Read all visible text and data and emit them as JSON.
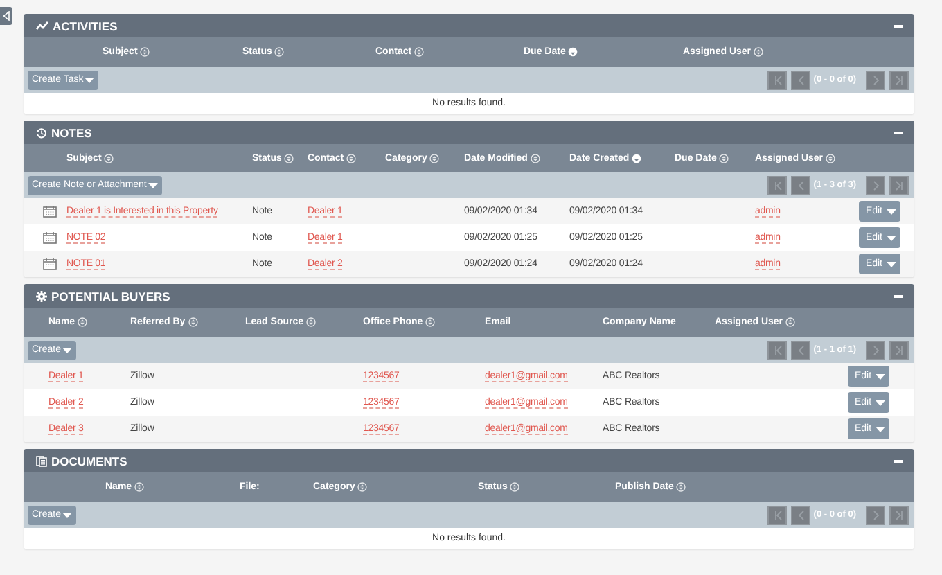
{
  "sidebar_toggle": {
    "kind": "collapse"
  },
  "panels": [
    {
      "title": "ACTIVITIES",
      "columns": [
        {
          "label": "Subject",
          "sortable": true,
          "sorted": false
        },
        {
          "label": "Status",
          "sortable": true,
          "sorted": false
        },
        {
          "label": "Contact",
          "sortable": true,
          "sorted": false
        },
        {
          "label": "Due Date",
          "sortable": true,
          "sorted": true
        },
        {
          "label": "Assigned User",
          "sortable": true,
          "sorted": false
        }
      ],
      "create_label": "Create Task",
      "pager": "(0 - 0 of 0)",
      "empty_message": "No results found."
    },
    {
      "title": "NOTES",
      "columns": [
        {
          "label": "Subject",
          "sortable": true,
          "sorted": false
        },
        {
          "label": "Status",
          "sortable": true,
          "sorted": false
        },
        {
          "label": "Contact",
          "sortable": true,
          "sorted": false
        },
        {
          "label": "Category",
          "sortable": true,
          "sorted": false
        },
        {
          "label": "Date Modified",
          "sortable": true,
          "sorted": false
        },
        {
          "label": "Date Created",
          "sortable": true,
          "sorted": true
        },
        {
          "label": "Due Date",
          "sortable": true,
          "sorted": false
        },
        {
          "label": "Assigned User",
          "sortable": true,
          "sorted": false
        }
      ],
      "create_label": "Create Note or Attachment",
      "pager": "(1 - 3 of 3)",
      "rows": [
        {
          "cells": [
            {
              "kind": "link",
              "text": "Dealer 1 is Interested in this Property"
            },
            {
              "kind": "text",
              "text": "Note"
            },
            {
              "kind": "link",
              "text": "Dealer 1"
            },
            {
              "kind": "blank"
            },
            {
              "kind": "text",
              "text": "09/02/2020 01:34"
            },
            {
              "kind": "text",
              "text": "09/02/2020 01:34"
            },
            {
              "kind": "blank"
            },
            {
              "kind": "link",
              "text": "admin"
            },
            {
              "kind": "edit",
              "text": "Edit"
            }
          ]
        },
        {
          "cells": [
            {
              "kind": "link",
              "text": "NOTE 02"
            },
            {
              "kind": "text",
              "text": "Note"
            },
            {
              "kind": "link",
              "text": "Dealer 1"
            },
            {
              "kind": "blank"
            },
            {
              "kind": "text",
              "text": "09/02/2020 01:25"
            },
            {
              "kind": "text",
              "text": "09/02/2020 01:25"
            },
            {
              "kind": "blank"
            },
            {
              "kind": "link",
              "text": "admin"
            },
            {
              "kind": "edit",
              "text": "Edit"
            }
          ]
        },
        {
          "cells": [
            {
              "kind": "link",
              "text": "NOTE 01"
            },
            {
              "kind": "text",
              "text": "Note"
            },
            {
              "kind": "link",
              "text": "Dealer 2"
            },
            {
              "kind": "blank"
            },
            {
              "kind": "text",
              "text": "09/02/2020 01:24"
            },
            {
              "kind": "text",
              "text": "09/02/2020 01:24"
            },
            {
              "kind": "blank"
            },
            {
              "kind": "link",
              "text": "admin"
            },
            {
              "kind": "edit",
              "text": "Edit"
            }
          ]
        }
      ]
    },
    {
      "title": "POTENTIAL BUYERS",
      "columns": [
        {
          "label": "Name",
          "sortable": true,
          "sorted": false
        },
        {
          "label": "Referred By",
          "sortable": true,
          "sorted": false
        },
        {
          "label": "Lead Source",
          "sortable": true,
          "sorted": false
        },
        {
          "label": "Office Phone",
          "sortable": true,
          "sorted": false
        },
        {
          "label": "Email",
          "sortable": false
        },
        {
          "label": "Company Name",
          "sortable": false
        },
        {
          "label": "Assigned User",
          "sortable": true,
          "sorted": false
        }
      ],
      "create_label": "Create",
      "pager": "(1 - 1 of 1)",
      "rows": [
        {
          "cells": [
            {
              "kind": "link",
              "text": "Dealer 1"
            },
            {
              "kind": "text",
              "text": "Zillow"
            },
            {
              "kind": "blank"
            },
            {
              "kind": "link",
              "text": "1234567"
            },
            {
              "kind": "link",
              "text": "dealer1@gmail.com"
            },
            {
              "kind": "text",
              "text": "ABC Realtors"
            },
            {
              "kind": "blank"
            },
            {
              "kind": "edit",
              "text": "Edit"
            }
          ]
        },
        {
          "cells": [
            {
              "kind": "link",
              "text": "Dealer 2"
            },
            {
              "kind": "text",
              "text": "Zillow"
            },
            {
              "kind": "blank"
            },
            {
              "kind": "link",
              "text": "1234567"
            },
            {
              "kind": "link",
              "text": "dealer1@gmail.com"
            },
            {
              "kind": "text",
              "text": "ABC Realtors"
            },
            {
              "kind": "blank"
            },
            {
              "kind": "edit",
              "text": "Edit"
            }
          ]
        },
        {
          "cells": [
            {
              "kind": "link",
              "text": "Dealer 3"
            },
            {
              "kind": "text",
              "text": "Zillow"
            },
            {
              "kind": "blank"
            },
            {
              "kind": "link",
              "text": "1234567"
            },
            {
              "kind": "link",
              "text": "dealer1@gmail.com"
            },
            {
              "kind": "text",
              "text": "ABC Realtors"
            },
            {
              "kind": "blank"
            },
            {
              "kind": "edit",
              "text": "Edit"
            }
          ]
        }
      ]
    },
    {
      "title": "DOCUMENTS",
      "columns": [
        {
          "label": "Name",
          "sortable": true,
          "sorted": false
        },
        {
          "label": "File:",
          "sortable": false
        },
        {
          "label": "Category",
          "sortable": true,
          "sorted": false
        },
        {
          "label": "Status",
          "sortable": true,
          "sorted": false
        },
        {
          "label": "Publish Date",
          "sortable": true,
          "sorted": false
        }
      ],
      "create_label": "Create",
      "pager": "(0 - 0 of 0)",
      "empty_message": "No results found."
    }
  ]
}
